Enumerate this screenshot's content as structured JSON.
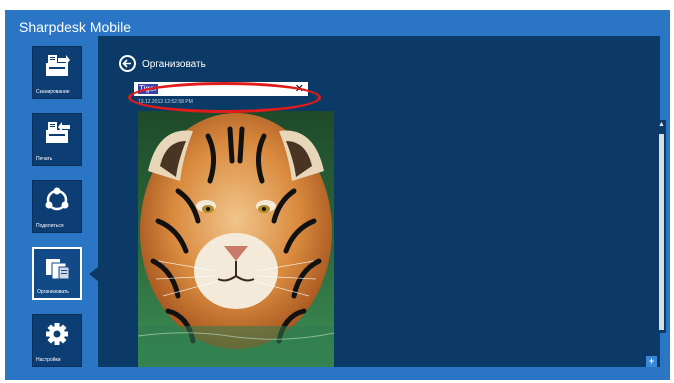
{
  "app": {
    "title": "Sharpdesk Mobile"
  },
  "sidebar": {
    "items": [
      {
        "label": "Сканирование",
        "icon": "scan-icon"
      },
      {
        "label": "Печать",
        "icon": "print-icon"
      },
      {
        "label": "Поделиться",
        "icon": "share-icon"
      },
      {
        "label": "Организовать",
        "icon": "organize-icon",
        "active": true
      },
      {
        "label": "Настройки",
        "icon": "settings-icon"
      }
    ]
  },
  "main": {
    "title": "Организовать",
    "search": {
      "value": "Tiger",
      "clear_label": "✕"
    },
    "file_meta": "13.12.2013 12:52:58 PM",
    "thumbnail_icon": "tiger-photo"
  },
  "scrollbar": {
    "up_label": "▲"
  },
  "corner_button": {
    "label": "+"
  },
  "colors": {
    "app_background": "#2a76c4",
    "panel_background": "#0b3a66",
    "sidebar_tile": "#0c3d73",
    "highlight": "#e01b1b",
    "search_selection": "#3d3fb0"
  }
}
